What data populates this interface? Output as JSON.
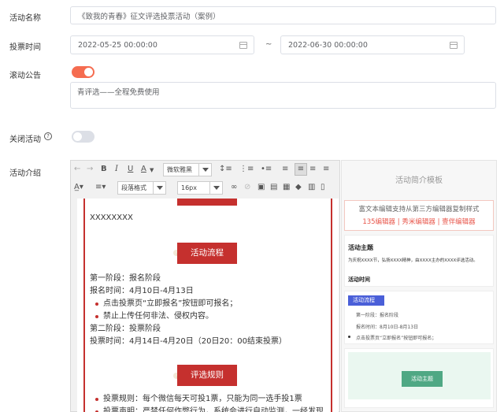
{
  "form": {
    "activity_name": {
      "label": "活动名称",
      "value": "《致我的青春》征文评选投票活动（案例）"
    },
    "vote_time": {
      "label": "投票时间",
      "start": "2022-05-25 00:00:00",
      "separator": "~",
      "end": "2022-06-30 00:00:00"
    },
    "marquee": {
      "label": "滚动公告",
      "enabled": true,
      "text": "青评选——全程免费使用"
    },
    "close_activity": {
      "label": "关闭活动",
      "help_icon": "question-circle-icon",
      "enabled": false
    },
    "intro": {
      "label": "活动介绍"
    }
  },
  "toolbar": {
    "font_family": "微软雅黑",
    "paragraph_format": "段落格式",
    "font_size": "16px",
    "bold": "B",
    "italic": "I",
    "underline": "U",
    "font_color": "A"
  },
  "editor": {
    "code_text": "XXXXXXXX",
    "banner_process": "活动流程",
    "stage1_title": "第一阶段：报名阶段",
    "stage1_time": "报名时间：4月10日-4月13日",
    "stage1_bullets": [
      "点击投票页“立即报名”按钮即可报名；",
      "禁止上传任何非法、侵权内容。"
    ],
    "stage2_title": "第二阶段：投票阶段",
    "stage2_time": "投票时间：4月14日-4月20日（20日20：00结束投票）",
    "banner_rules": "评选规则",
    "rules_bullets": [
      "投票规则：每个微信每天可投1票，只能为同一选手投1票",
      "投票声明：严禁任何作弊行为，系统会进行自动监测，一经发现"
    ]
  },
  "template_panel": {
    "title": "活动简介模板",
    "notice": "富文本编辑支持从第三方编辑器复制样式",
    "editors": [
      "135编辑器",
      "秀米编辑器",
      "壹伴编辑器"
    ],
    "divider": "|",
    "card1": {
      "title": "活动主题",
      "body": "为庆祝XXXX节，弘扬XXXX精神，由XXXX主办的XXXX评选活动。",
      "extra": "活动时间"
    },
    "card2": {
      "tag": "活动流程",
      "line1": "第一阶段：报名阶段",
      "line2": "报名时间：8月10日-8月13日",
      "line3": "点击投票页“立即报名”按钮即可报名；"
    },
    "card3": {
      "button": "活动主题"
    }
  },
  "colors": {
    "accent": "#f56c50",
    "banner": "#c5302e",
    "link": "#e8554a",
    "card_tag": "#4a5fd8",
    "card_bg": "#eaf7f0",
    "card_btn": "#4fa884"
  }
}
